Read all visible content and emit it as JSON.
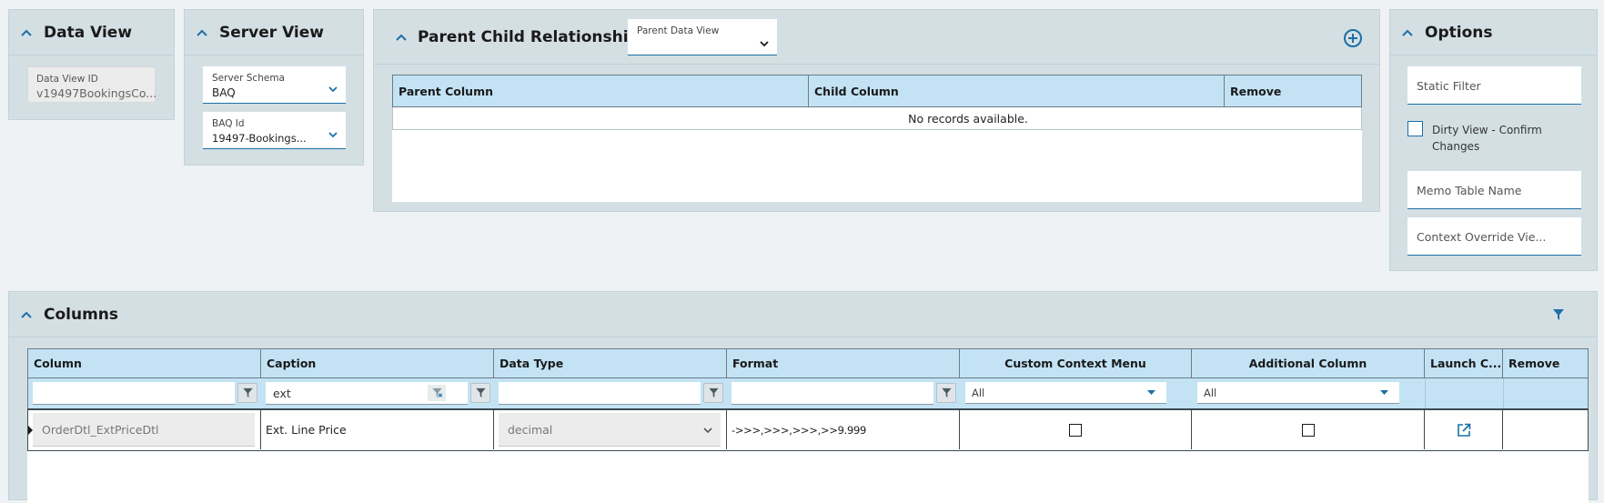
{
  "data_view_panel": {
    "title": "Data View",
    "field_label": "Data View ID",
    "field_value": "v19497BookingsCo..."
  },
  "server_view_panel": {
    "title": "Server View",
    "schema_label": "Server Schema",
    "schema_value": "BAQ",
    "baq_label": "BAQ Id",
    "baq_value": "19497-Bookings..."
  },
  "relationships_panel": {
    "title": "Parent Child Relationships",
    "parent_data_view_label": "Parent Data View",
    "columns": [
      "Parent Column",
      "Child Column",
      "Remove"
    ],
    "empty_message": "No records available."
  },
  "options_panel": {
    "title": "Options",
    "static_filter_placeholder": "Static Filter",
    "dirty_view_label": "Dirty View - Confirm Changes",
    "memo_table_placeholder": "Memo Table Name",
    "context_override_placeholder": "Context Override Vie..."
  },
  "columns_panel": {
    "title": "Columns",
    "headers": [
      "Column",
      "Caption",
      "Data Type",
      "Format",
      "Custom Context Menu",
      "Additional Column",
      "Launch C...",
      "Remove"
    ],
    "filters": {
      "caption_value": "ext",
      "custom_context_menu": "All",
      "additional_column": "All"
    },
    "rows": [
      {
        "column": "OrderDtl_ExtPriceDtl",
        "caption": "Ext. Line Price",
        "data_type": "decimal",
        "format": "->>>,>>>,>>>,>>9.999",
        "custom_context_menu": false,
        "additional_column": false
      }
    ]
  },
  "icons": [
    "chevron-up-icon",
    "chevron-down-icon",
    "add-circle-icon",
    "filter-icon",
    "clear-filter-icon",
    "launch-icon",
    "row-indicator-icon"
  ],
  "colors": {
    "accent": "#1d6fa5",
    "header_bg": "#c3e3f5",
    "panel_bg": "#d4dfe4",
    "page_bg": "#eef2f4"
  }
}
